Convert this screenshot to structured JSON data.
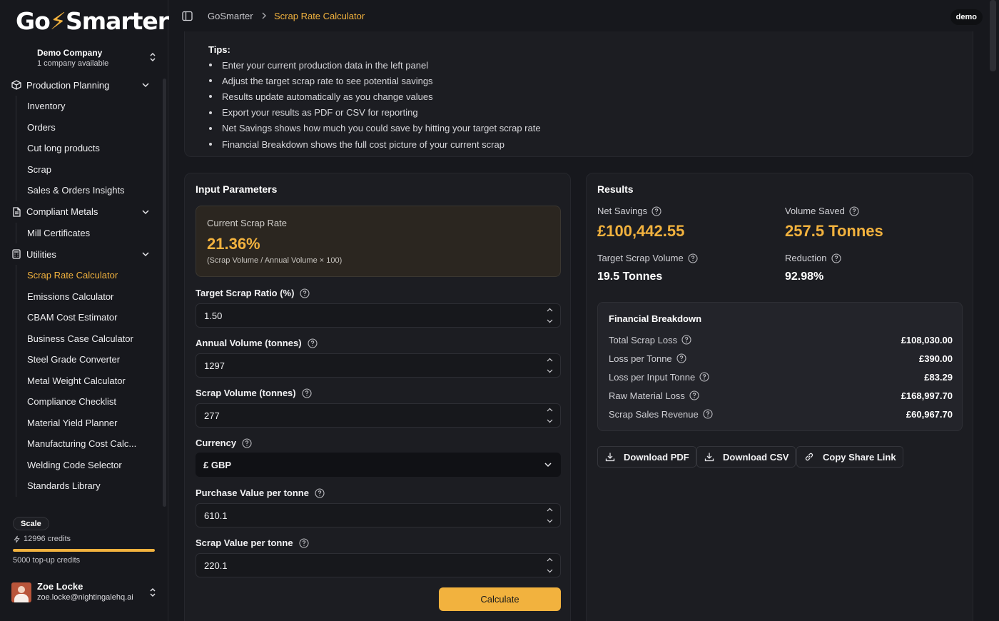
{
  "brand": {
    "logo_pre": "Go",
    "logo_bolt": "⚡",
    "logo_post": "Smarter"
  },
  "company": {
    "name": "Demo Company",
    "subtitle": "1 company available"
  },
  "nav": {
    "production": {
      "label": "Production Planning",
      "items": [
        "Inventory",
        "Orders",
        "Cut long products",
        "Scrap",
        "Sales & Orders Insights"
      ]
    },
    "compliant": {
      "label": "Compliant Metals",
      "items": [
        "Mill Certificates"
      ]
    },
    "utilities": {
      "label": "Utilities",
      "items": [
        "Scrap Rate Calculator",
        "Emissions Calculator",
        "CBAM Cost Estimator",
        "Business Case Calculator",
        "Steel Grade Converter",
        "Metal Weight Calculator",
        "Compliance Checklist",
        "Material Yield Planner",
        "Manufacturing Cost Calc...",
        "Welding Code Selector",
        "Standards Library"
      ],
      "active": "Scrap Rate Calculator"
    }
  },
  "plan": {
    "badge": "Scale",
    "credits": "12996 credits",
    "credits_fill_fraction": 1.0,
    "topup": "5000 top-up credits"
  },
  "user": {
    "name": "Zoe Locke",
    "email": "zoe.locke@nightingalehq.ai"
  },
  "header": {
    "home": "GoSmarter",
    "current": "Scrap Rate Calculator",
    "badge": "demo"
  },
  "tips": {
    "title": "Tips:",
    "items": [
      "Enter your current production data in the left panel",
      "Adjust the target scrap rate to see potential savings",
      "Results update automatically as you change values",
      "Export your results as PDF or CSV for reporting",
      "Net Savings shows how much you could save by hitting your target scrap rate",
      "Financial Breakdown shows the full cost picture of your current scrap"
    ]
  },
  "input": {
    "title": "Input Parameters",
    "current_rate": {
      "label": "Current Scrap Rate",
      "value": "21.36%",
      "formula": "(Scrap Volume / Annual Volume × 100)"
    },
    "target_ratio": {
      "label": "Target Scrap Ratio (%)",
      "value": "1.50"
    },
    "annual_volume": {
      "label": "Annual Volume (tonnes)",
      "value": "1297"
    },
    "scrap_volume": {
      "label": "Scrap Volume (tonnes)",
      "value": "277"
    },
    "currency": {
      "label": "Currency",
      "value": "£ GBP"
    },
    "purchase_value": {
      "label": "Purchase Value per tonne",
      "value": "610.1"
    },
    "scrap_value": {
      "label": "Scrap Value per tonne",
      "value": "220.1"
    },
    "calculate_label": "Calculate"
  },
  "results": {
    "title": "Results",
    "net_savings": {
      "label": "Net Savings",
      "value": "£100,442.55"
    },
    "volume_saved": {
      "label": "Volume Saved",
      "value": "257.5 Tonnes"
    },
    "target_scrap_volume": {
      "label": "Target Scrap Volume",
      "value": "19.5 Tonnes"
    },
    "reduction": {
      "label": "Reduction",
      "value": "92.98%"
    },
    "breakdown": {
      "title": "Financial Breakdown",
      "rows": [
        {
          "label": "Total Scrap Loss",
          "value": "£108,030.00"
        },
        {
          "label": "Loss per Tonne",
          "value": "£390.00"
        },
        {
          "label": "Loss per Input Tonne",
          "value": "£83.29"
        },
        {
          "label": "Raw Material Loss",
          "value": "£168,997.70"
        },
        {
          "label": "Scrap Sales Revenue",
          "value": "£60,967.70"
        }
      ]
    },
    "actions": {
      "pdf": "Download PDF",
      "csv": "Download CSV",
      "share": "Copy Share Link"
    }
  },
  "colors": {
    "accent": "#f2b23e",
    "background": "#17181d",
    "card": "#1c1d22"
  }
}
